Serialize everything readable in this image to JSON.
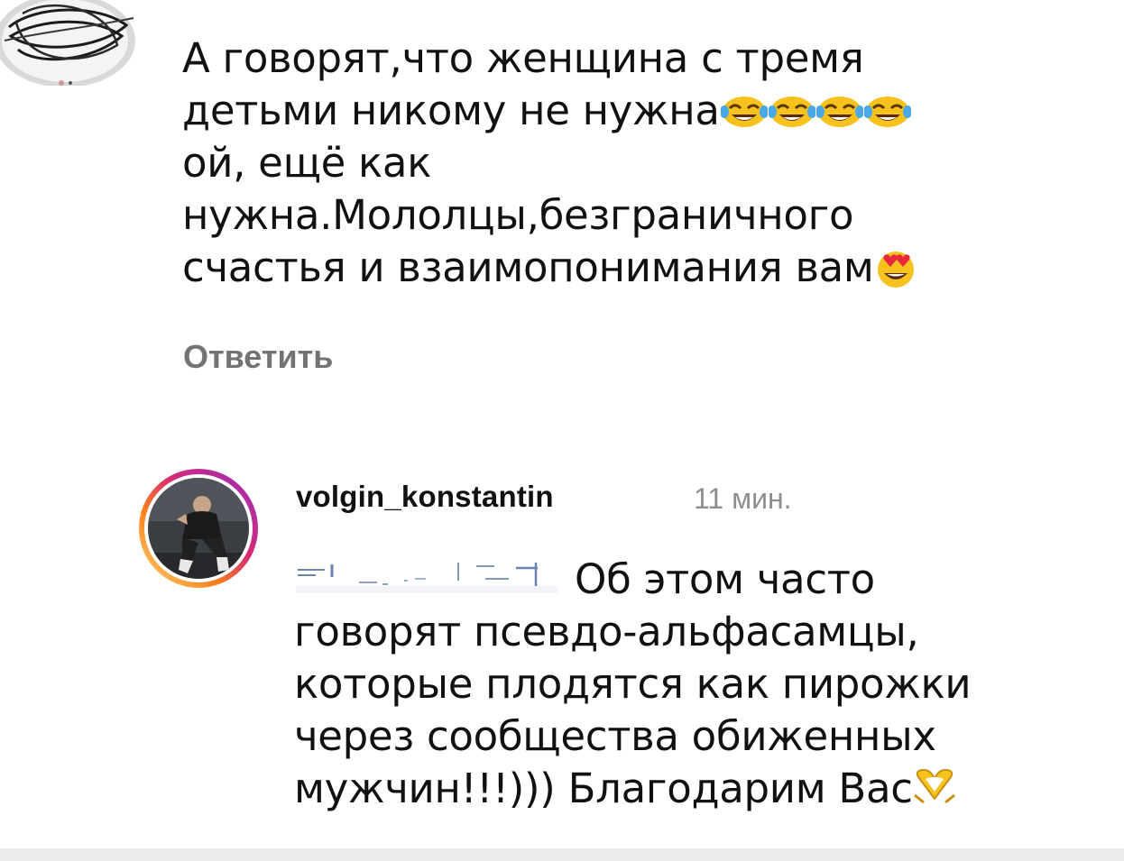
{
  "comment_1": {
    "text": "А говорят,что женщина с тремя\nдетьми никому не нужна",
    "text_cont": "\nой, ещё как\nнужна.Мололцы,безграничного\nсчастья и взаимопонимания вам",
    "emojis_laugh": [
      "face-with-tears-of-joy-icon",
      "face-with-tears-of-joy-icon",
      "face-with-tears-of-joy-icon",
      "face-with-tears-of-joy-icon"
    ],
    "emoji_end": "smiling-face-with-heart-eyes-icon",
    "reply_label": "Ответить"
  },
  "comment_2": {
    "username": "volgin_konstantin",
    "time": "11 мин.",
    "line1": "Об этом часто",
    "rest": "говорят псевдо-альфасамцы,\nкоторые плодятся как пирожки\nчерез сообщества обиженных\nмужчин!!!))) Благодарим Вас",
    "emoji_end": "heart-hands-icon"
  },
  "colors": {
    "text": "#111111",
    "muted": "#737373",
    "timestamp": "#8e8e8e",
    "mention": "#4a6fa5"
  }
}
